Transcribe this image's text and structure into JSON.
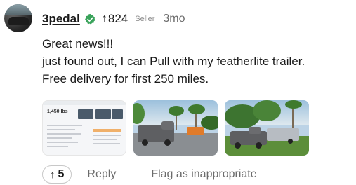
{
  "comment": {
    "author": {
      "username": "3pedal",
      "verified": true,
      "points": "824",
      "role_badge": "Seller",
      "age": "3mo"
    },
    "body_lines": [
      "Great news!!!",
      "just found out, I can Pull with my featherlite trailer.",
      "Free delivery for first 250 miles."
    ],
    "thumbnails": [
      {
        "kind": "listing-screenshot",
        "price": "1,450 lbs"
      },
      {
        "kind": "photo"
      },
      {
        "kind": "photo"
      }
    ],
    "actions": {
      "upvotes": "5",
      "reply_label": "Reply",
      "flag_label": "Flag as inappropriate"
    }
  },
  "icons": {
    "verified": "verified-check-icon",
    "points_arrow": "arrow-up-icon",
    "vote_arrow": "arrow-up-icon"
  },
  "colors": {
    "verified_green": "#3aa35b",
    "muted_text": "#6b6b6b"
  }
}
